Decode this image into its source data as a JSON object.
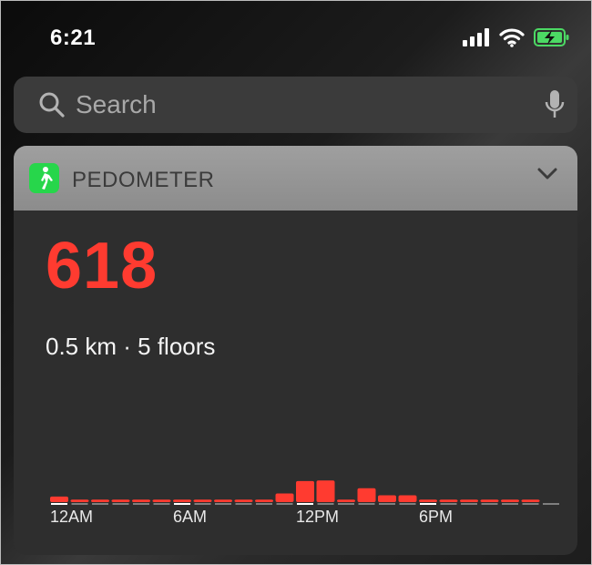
{
  "status_bar": {
    "time": "6:21",
    "icons": [
      "signal-icon",
      "wifi-icon",
      "battery-charging-icon"
    ]
  },
  "search": {
    "placeholder": "Search",
    "icons": [
      "search-icon",
      "microphone-icon"
    ]
  },
  "widget": {
    "app_name": "PEDOMETER",
    "app_icon": "walking-person-icon",
    "collapse_icon": "chevron-down-icon",
    "steps": "618",
    "summary": "0.5 km · 5 floors",
    "accent_color": "#ff3b30"
  },
  "chart_data": {
    "type": "bar",
    "categories": [
      "0",
      "1",
      "2",
      "3",
      "4",
      "5",
      "6",
      "7",
      "8",
      "9",
      "10",
      "11",
      "12",
      "13",
      "14",
      "15",
      "16",
      "17",
      "18",
      "19",
      "20",
      "21",
      "22",
      "23"
    ],
    "values": [
      18,
      8,
      8,
      8,
      8,
      8,
      8,
      8,
      8,
      8,
      8,
      28,
      68,
      70,
      8,
      45,
      22,
      22,
      8,
      8,
      8,
      8,
      8,
      8
    ],
    "tick_labels": [
      {
        "at": "0",
        "label": "12AM"
      },
      {
        "at": "6",
        "label": "6AM"
      },
      {
        "at": "12",
        "label": "12PM"
      },
      {
        "at": "18",
        "label": "6PM"
      }
    ],
    "ylim": [
      0,
      100
    ],
    "grid": false,
    "bar_color": "#ff3b30",
    "baseline_color": "#9a9a9a"
  }
}
